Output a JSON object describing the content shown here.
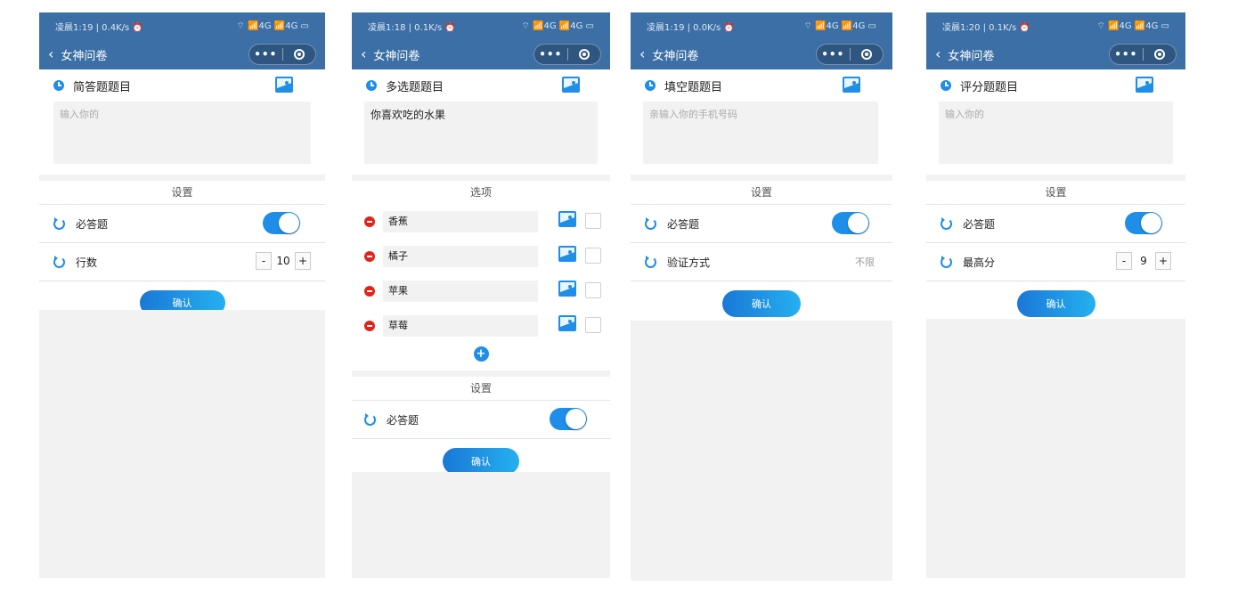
{
  "app": {
    "back_icon": "‹",
    "title": "女神问卷",
    "menu_dots": "•••"
  },
  "icons": {
    "status_signals": "⌔ 📶4G 📶4G ▭",
    "question_icon": "clock-icon",
    "image_icon": "image-icon",
    "setting_icon": "refresh-icon"
  },
  "screens": [
    {
      "status_left": "凌晨1:19 | 0.4K/s ⏰",
      "question_title": "简答题题目",
      "input_placeholder": "输入你的",
      "settings_title": "设置",
      "required_label": "必答题",
      "rows_label": "行数",
      "rows_value": "10",
      "minus": "-",
      "plus": "+",
      "confirm": "确认"
    },
    {
      "status_left": "凌晨1:18 | 0.1K/s ⏰",
      "question_title": "多选题题目",
      "input_value": "你喜欢吃的水果",
      "options_title": "选项",
      "options": [
        "香蕉",
        "橘子",
        "苹果",
        "草莓"
      ],
      "add_icon": "+",
      "settings_title": "设置",
      "required_label": "必答题",
      "confirm": "确认"
    },
    {
      "status_left": "凌晨1:19 | 0.0K/s ⏰",
      "question_title": "填空题题目",
      "input_placeholder": "亲输入你的手机号码",
      "settings_title": "设置",
      "required_label": "必答题",
      "verify_label": "验证方式",
      "verify_value": "不限",
      "confirm": "确认"
    },
    {
      "status_left": "凌晨1:20 | 0.1K/s ⏰",
      "question_title": "评分题题目",
      "input_placeholder": "输入你的",
      "settings_title": "设置",
      "required_label": "必答题",
      "max_label": "最高分",
      "max_value": "9",
      "minus": "-",
      "plus": "+",
      "confirm": "确认"
    }
  ],
  "colors": {
    "header_blue": "#3b6fa6",
    "accent_blue": "#1e8ee8",
    "delete_red": "#e2231a",
    "panel_gray": "#f2f2f2"
  }
}
